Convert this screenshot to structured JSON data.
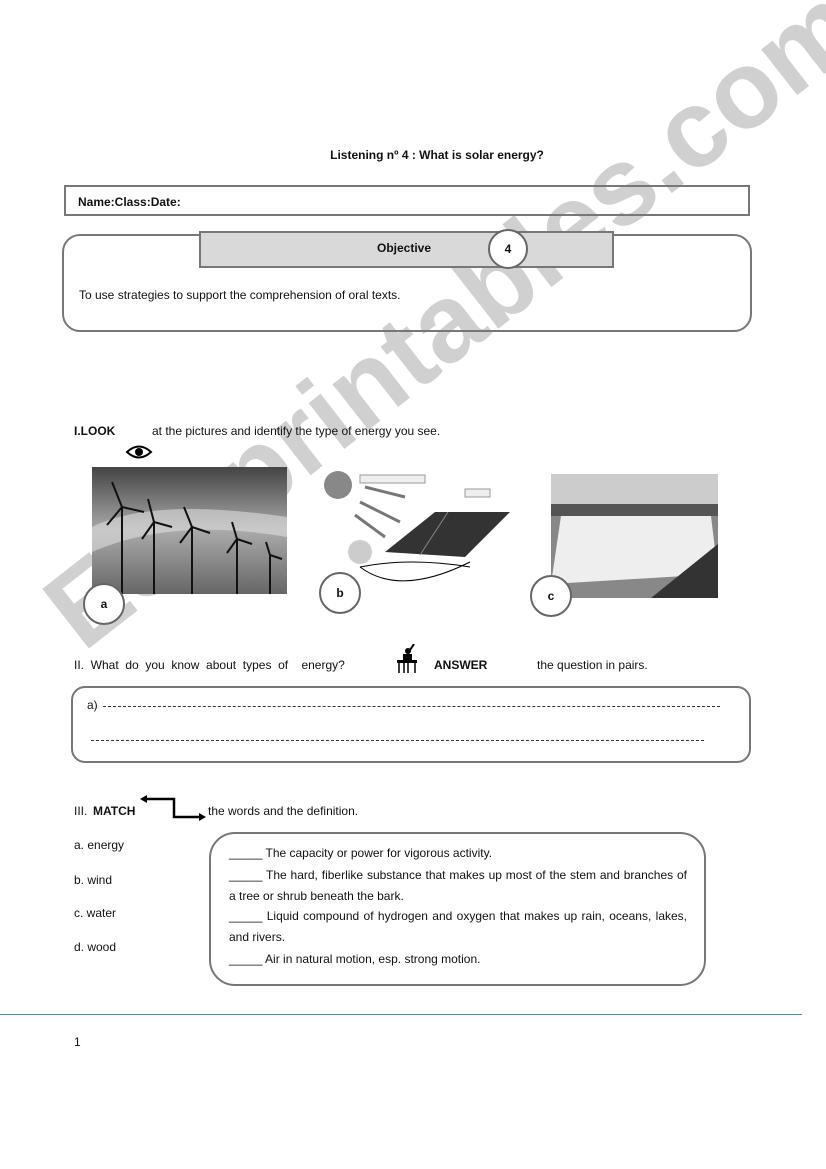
{
  "title": "Listening  nº 4 : What is solar energy?",
  "name_line": "Name:Class:Date:",
  "objective": {
    "label": "Objective",
    "number": "4",
    "text": "To use strategies to support the comprehension of oral texts."
  },
  "section1": {
    "heading": "I.LOOK",
    "instruction": "at the pictures and identify the type of energy you see.",
    "icon": "eye-icon",
    "pictures": [
      {
        "label": "a",
        "subject": "wind turbines"
      },
      {
        "label": "b",
        "subject": "solar panel"
      },
      {
        "label": "c",
        "subject": "hydroelectric dam"
      }
    ]
  },
  "section2": {
    "question": "II.  What  do  you  know  about  types  of    energy?",
    "icon": "student-at-desk-icon",
    "keyword": "ANSWER",
    "instruction": "the question in pairs.",
    "answer_prefix": "a)"
  },
  "section3": {
    "heading_prefix": "III.",
    "keyword": "MATCH",
    "icon": "matching-arrows-icon",
    "instruction": "the words and the definition.",
    "words": [
      "a. energy",
      "b. wind",
      "c. water",
      "d. wood"
    ],
    "definitions": [
      "_____ The capacity or power for vigorous activity.",
      "_____ The hard, fiberlike substance that makes up most of the stem and branches of a tree or shrub beneath the bark.",
      "_____ Liquid compound of hydrogen and oxygen that makes up rain, oceans, lakes, and rivers.",
      "_____ Air in natural motion, esp. strong motion."
    ]
  },
  "page_number": "1",
  "watermark": "ESLprintables.com"
}
